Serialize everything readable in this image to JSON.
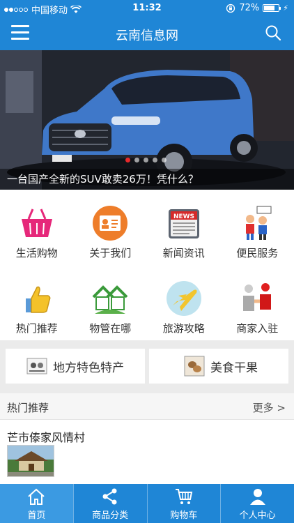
{
  "status": {
    "carrier": "中国移动",
    "time": "11:32",
    "battery": "72%",
    "battery_level": 0.72
  },
  "header": {
    "title": "云南信息网",
    "menu_icon": "menu-icon",
    "search_icon": "search-icon"
  },
  "banner": {
    "caption": "一台国产全新的SUV敢卖26万！凭什么？",
    "slides": 5,
    "active_slide": 0
  },
  "categories": [
    {
      "label": "生活购物",
      "icon": "shopping-basket-icon"
    },
    {
      "label": "关于我们",
      "icon": "id-card-icon"
    },
    {
      "label": "新闻资讯",
      "icon": "news-icon"
    },
    {
      "label": "便民服务",
      "icon": "people-service-icon"
    },
    {
      "label": "热门推荐",
      "icon": "thumbs-up-icon"
    },
    {
      "label": "物管在哪",
      "icon": "property-house-icon"
    },
    {
      "label": "旅游攻略",
      "icon": "airplane-icon"
    },
    {
      "label": "商家入驻",
      "icon": "handshake-icon"
    }
  ],
  "specials": [
    {
      "label": "地方特色特产",
      "icon": "local-products-icon"
    },
    {
      "label": "美食干果",
      "icon": "nuts-icon"
    }
  ],
  "hot": {
    "title": "热门推荐",
    "more": "更多 >",
    "items": [
      {
        "name": "芒市傣家风情村",
        "thumb": "village-photo"
      }
    ]
  },
  "tabs": [
    {
      "label": "首页",
      "icon": "home-icon",
      "active": true
    },
    {
      "label": "商品分类",
      "icon": "share-icon",
      "active": false
    },
    {
      "label": "购物车",
      "icon": "cart-icon",
      "active": false
    },
    {
      "label": "个人中心",
      "icon": "user-icon",
      "active": false
    }
  ],
  "colors": {
    "brand": "#1f86d6",
    "pager_active": "#e8292b"
  }
}
